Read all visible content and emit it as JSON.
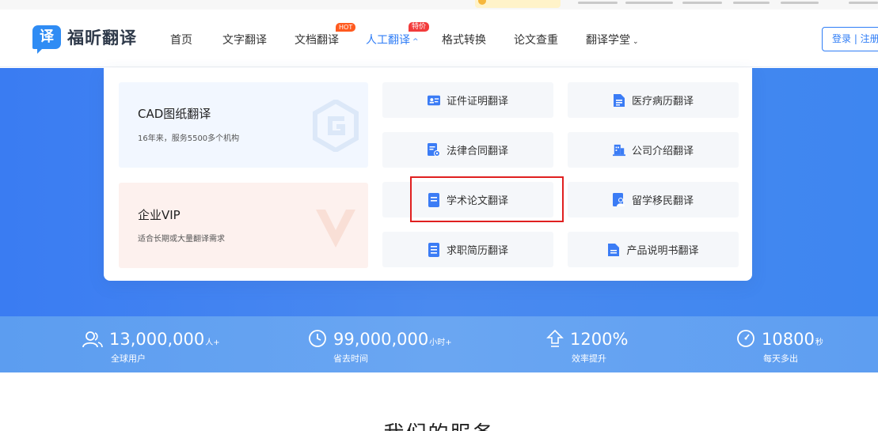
{
  "site": {
    "logo_glyph": "译",
    "logo_text": "福昕翻译"
  },
  "nav": {
    "items": [
      {
        "label": "首页"
      },
      {
        "label": "文字翻译"
      },
      {
        "label": "文档翻译",
        "badge": "HOT"
      },
      {
        "label": "人工翻译",
        "badge": "特价",
        "active": true,
        "chevron": "^"
      },
      {
        "label": "格式转换"
      },
      {
        "label": "论文查重"
      },
      {
        "label": "翻译学堂",
        "chevron": "⌄"
      }
    ]
  },
  "auth": {
    "label": "登录 | 注册"
  },
  "dropdown": {
    "promos": [
      {
        "title": "CAD图纸翻译",
        "subtitle": "16年来，服务5500多个机构"
      },
      {
        "title": "企业VIP",
        "subtitle": "适合长期或大量翻译需求"
      }
    ],
    "services": [
      {
        "label": "证件证明翻译",
        "icon": "id-card-icon"
      },
      {
        "label": "医疗病历翻译",
        "icon": "medical-record-icon"
      },
      {
        "label": "法律合同翻译",
        "icon": "contract-icon"
      },
      {
        "label": "公司介绍翻译",
        "icon": "company-icon"
      },
      {
        "label": "学术论文翻译",
        "icon": "paper-icon"
      },
      {
        "label": "留学移民翻译",
        "icon": "immigration-icon"
      },
      {
        "label": "求职简历翻译",
        "icon": "resume-icon"
      },
      {
        "label": "产品说明书翻译",
        "icon": "manual-icon"
      }
    ]
  },
  "stats": [
    {
      "value": "13,000,000",
      "unit": "人+",
      "caption": "全球用户",
      "icon": "users-icon"
    },
    {
      "value": "99,000,000",
      "unit": "小时+",
      "caption": "省去时间",
      "icon": "clock-icon"
    },
    {
      "value": "1200%",
      "unit": "",
      "caption": "效率提升",
      "icon": "upload-arrow-icon"
    },
    {
      "value": "10800",
      "unit": "秒",
      "caption": "每天多出",
      "icon": "timer-icon"
    }
  ],
  "section": {
    "title": "我们的服务"
  },
  "colors": {
    "accent": "#2f7df6",
    "badge_hot": "#ff5a1f",
    "badge_sale": "#f23b3b",
    "highlight": "#e02020"
  }
}
